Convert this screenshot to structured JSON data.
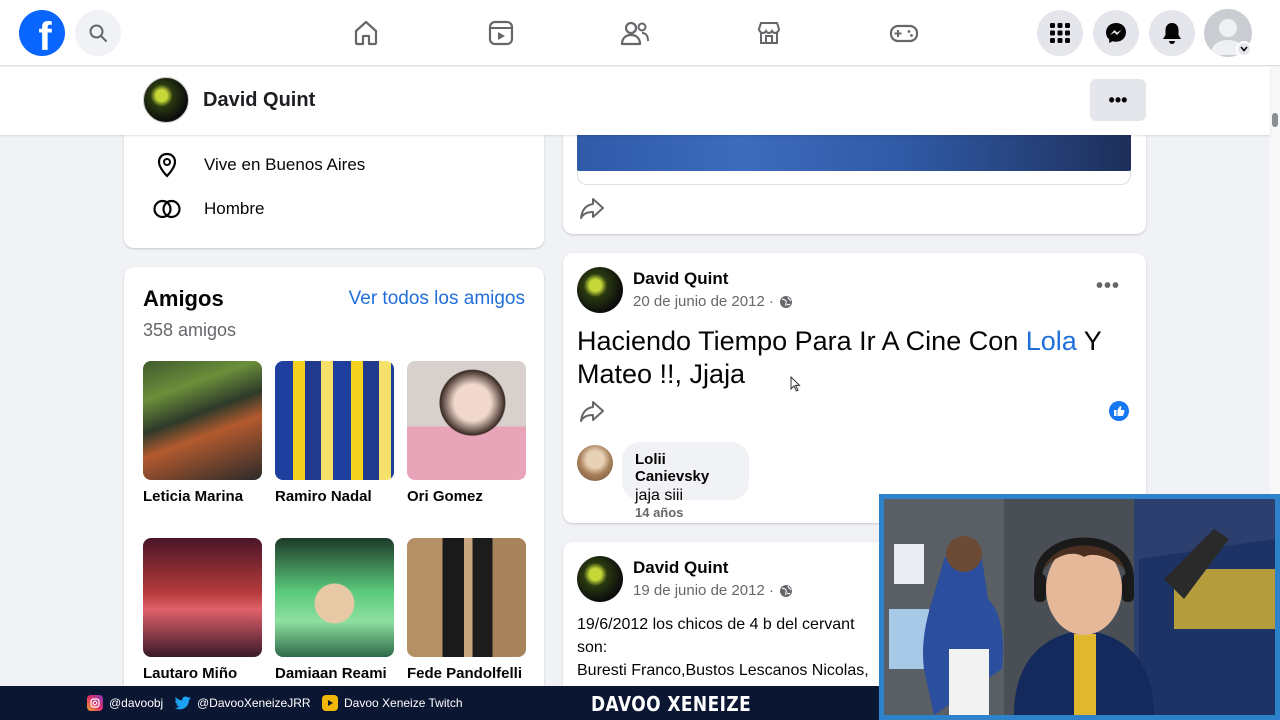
{
  "topnav": {
    "logo": "f",
    "icons": [
      "search-icon",
      "home-icon",
      "reels-icon",
      "friends-icon",
      "marketplace-icon",
      "gaming-icon",
      "apps-menu-icon",
      "messenger-icon",
      "notifications-icon",
      "account-icon"
    ]
  },
  "profile": {
    "name": "David Quint",
    "more": "•••"
  },
  "intro": {
    "location": "Vive en Buenos Aires",
    "gender": "Hombre"
  },
  "friends": {
    "title": "Amigos",
    "see_all": "Ver todos los amigos",
    "count": "358 amigos",
    "list": [
      {
        "name": "Leticia Marina"
      },
      {
        "name": "Ramiro Nadal"
      },
      {
        "name": "Ori Gomez"
      },
      {
        "name": "Lautaro Miño"
      },
      {
        "name": "Damiaan Reami"
      },
      {
        "name": "Fede Pandolfelli"
      }
    ]
  },
  "posts": [
    {
      "author": "David Quint",
      "date": "20 de junio de 2012 ·",
      "text_before": "Haciendo Tiempo Para Ir A Cine Con ",
      "mention": "Lola",
      "text_after": " Y Mateo !!, Jjaja",
      "comment": {
        "author": "Lolii Canievsky",
        "text": "jaja siii",
        "age": "14 años"
      }
    },
    {
      "author": "David Quint",
      "date": "19 de junio de 2012 ·",
      "lines": [
        "19/6/2012 los chicos de 4 b del cervant",
        "son:",
        "Buresti Franco,Bustos Lescanos Nicolas,"
      ]
    }
  ],
  "stream": {
    "instagram": "@davoobj",
    "twitter": "@DavooXeneizeJRR",
    "youtube": "Davoo Xeneize Twitch",
    "brand": "DAVOO XENEIZE"
  },
  "colors": {
    "facebook_blue": "#0866ff",
    "link_blue": "#216fdb",
    "stream_bar": "#0b1732",
    "webcam_border": "#2d82c9"
  }
}
